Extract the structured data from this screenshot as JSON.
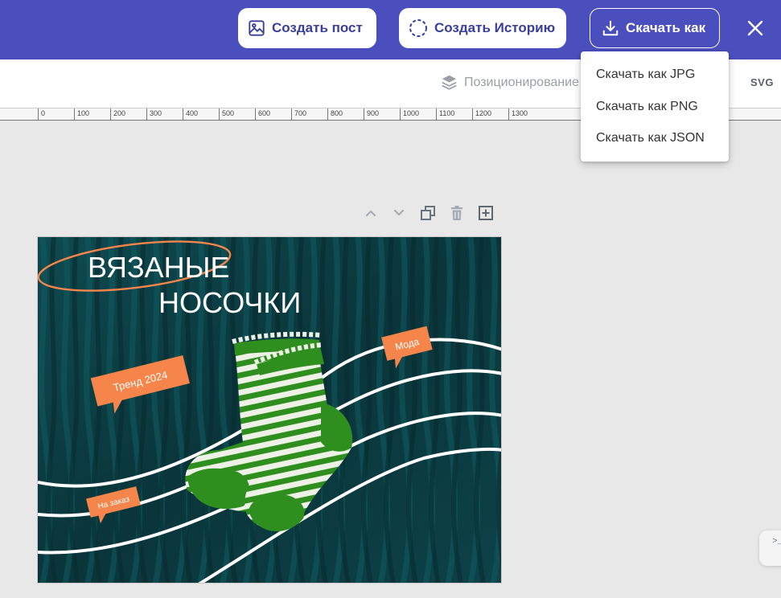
{
  "header": {
    "create_post": "Создать пост",
    "create_story": "Создать Историю",
    "download_as": "Скачать как"
  },
  "toolbar": {
    "positioning": "Позиционирование",
    "svg": "SVG"
  },
  "ruler": {
    "ticks": [
      "0",
      "100",
      "200",
      "300",
      "400",
      "500",
      "600",
      "700",
      "800",
      "900",
      "1000",
      "1100",
      "1200",
      "1300"
    ]
  },
  "download_menu": {
    "items": [
      "Скачать как JPG",
      "Скачать как PNG",
      "Скачать как JSON"
    ]
  },
  "design": {
    "title_line1": "ВЯЗАНЫЕ",
    "title_line2": "НОСОЧКИ",
    "tag_trend": "Тренд 2024",
    "tag_fashion": "Мода",
    "tag_order": "На заказ"
  },
  "colors": {
    "header_bg": "#4a4fbd",
    "accent_orange": "#f5854a",
    "canvas_bg": "#0b3a3f",
    "sock_green": "#2e8f1f"
  },
  "icons": {
    "post": "image-icon",
    "story": "dashed-circle-icon",
    "download": "download-icon",
    "close": "close-icon",
    "positioning": "layers-icon",
    "up": "chevron-up-icon",
    "down": "chevron-down-icon",
    "duplicate": "duplicate-icon",
    "delete": "trash-icon",
    "add": "add-box-icon"
  }
}
